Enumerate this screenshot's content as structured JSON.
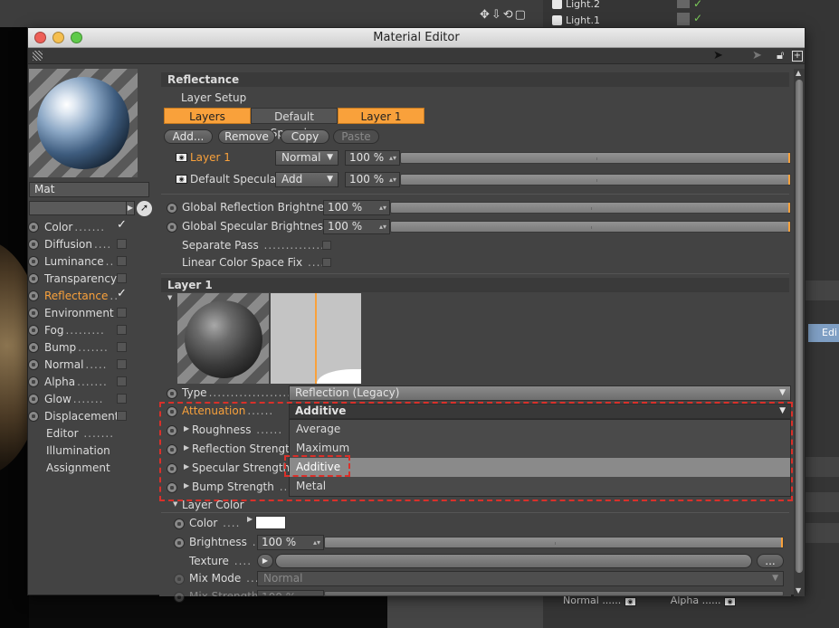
{
  "window": {
    "title": "Material Editor"
  },
  "background": {
    "lights": [
      {
        "label": "Light.2"
      },
      {
        "label": "Light.1"
      }
    ],
    "edit_tab": "Edi",
    "bottom_props": {
      "normal": "Normal",
      "alpha": "Alpha",
      "dots": "......"
    }
  },
  "material": {
    "name": "Mat"
  },
  "channels": [
    {
      "label": "Color",
      "dots": ".......",
      "state": "checked"
    },
    {
      "label": "Diffusion",
      "dots": "....",
      "state": "box"
    },
    {
      "label": "Luminance",
      "dots": "..",
      "state": "box"
    },
    {
      "label": "Transparency",
      "dots": "",
      "state": "box"
    },
    {
      "label": "Reflectance",
      "dots": "..",
      "state": "checked",
      "active": true
    },
    {
      "label": "Environment",
      "dots": "",
      "state": "box"
    },
    {
      "label": "Fog",
      "dots": ".........",
      "state": "box"
    },
    {
      "label": "Bump",
      "dots": ".......",
      "state": "box"
    },
    {
      "label": "Normal",
      "dots": ".....",
      "state": "box"
    },
    {
      "label": "Alpha",
      "dots": ".......",
      "state": "box"
    },
    {
      "label": "Glow",
      "dots": ".......",
      "state": "box"
    },
    {
      "label": "Displacement",
      "dots": "",
      "state": "box"
    }
  ],
  "extra_items": [
    {
      "label": "Editor",
      "dots": "......."
    },
    {
      "label": "Illumination",
      "dots": ""
    },
    {
      "label": "Assignment",
      "dots": ""
    }
  ],
  "reflectance": {
    "title": "Reflectance",
    "layer_setup": "Layer Setup",
    "tabs": [
      {
        "label": "Layers"
      },
      {
        "label": "Default Specular"
      },
      {
        "label": "Layer 1"
      }
    ],
    "buttons": {
      "add": "Add...",
      "remove": "Remove",
      "copy": "Copy",
      "paste": "Paste"
    },
    "layers": [
      {
        "name": "Layer 1",
        "mode": "Normal",
        "amount": "100 %",
        "amount_fraction": 1.0
      },
      {
        "name": "Default Specular",
        "mode": "Add",
        "amount": "100 %",
        "amount_fraction": 1.0
      }
    ],
    "global_reflection_brightness": {
      "label": "Global Reflection Brightness",
      "value": "100 %",
      "fraction": 1.0
    },
    "global_specular_brightness": {
      "label": "Global Specular Brightness",
      "value": "100 %",
      "fraction": 1.0
    },
    "separate_pass": {
      "label": "Separate Pass",
      "dots": ".............."
    },
    "linear_color_space_fix": {
      "label": "Linear Color Space Fix",
      "dots": "....."
    }
  },
  "layer1": {
    "title": "Layer 1",
    "type": {
      "label": "Type",
      "dots": "...........................",
      "value": "Reflection (Legacy)"
    },
    "attenuation": {
      "label": "Attenuation",
      "dots": "......",
      "value": "Additive"
    },
    "attenuation_options": [
      "Average",
      "Maximum",
      "Additive",
      "Metal"
    ],
    "attenuation_selected": "Additive",
    "roughness": {
      "label": "Roughness",
      "dots": "......"
    },
    "reflection_strength": {
      "label": "Reflection Strength"
    },
    "specular_strength": {
      "label": "Specular Strength"
    },
    "bump_strength": {
      "label": "Bump Strength",
      "dots": "..."
    }
  },
  "layer_color": {
    "title": "Layer Color",
    "color": {
      "label": "Color",
      "dots": "....",
      "swatch": "#ffffff"
    },
    "brightness": {
      "label": "Brightness",
      "dots": "..",
      "value": "100 %",
      "fraction": 1.0
    },
    "texture": {
      "label": "Texture",
      "dots": "....",
      "browse": "..."
    },
    "mix_mode": {
      "label": "Mix Mode",
      "dots": "....",
      "value": "Normal"
    },
    "mix_strength": {
      "label": "Mix Strength",
      "value": "100 %"
    }
  },
  "colors": {
    "accent": "#f9a13b",
    "highlight_dash": "#d9302a"
  }
}
